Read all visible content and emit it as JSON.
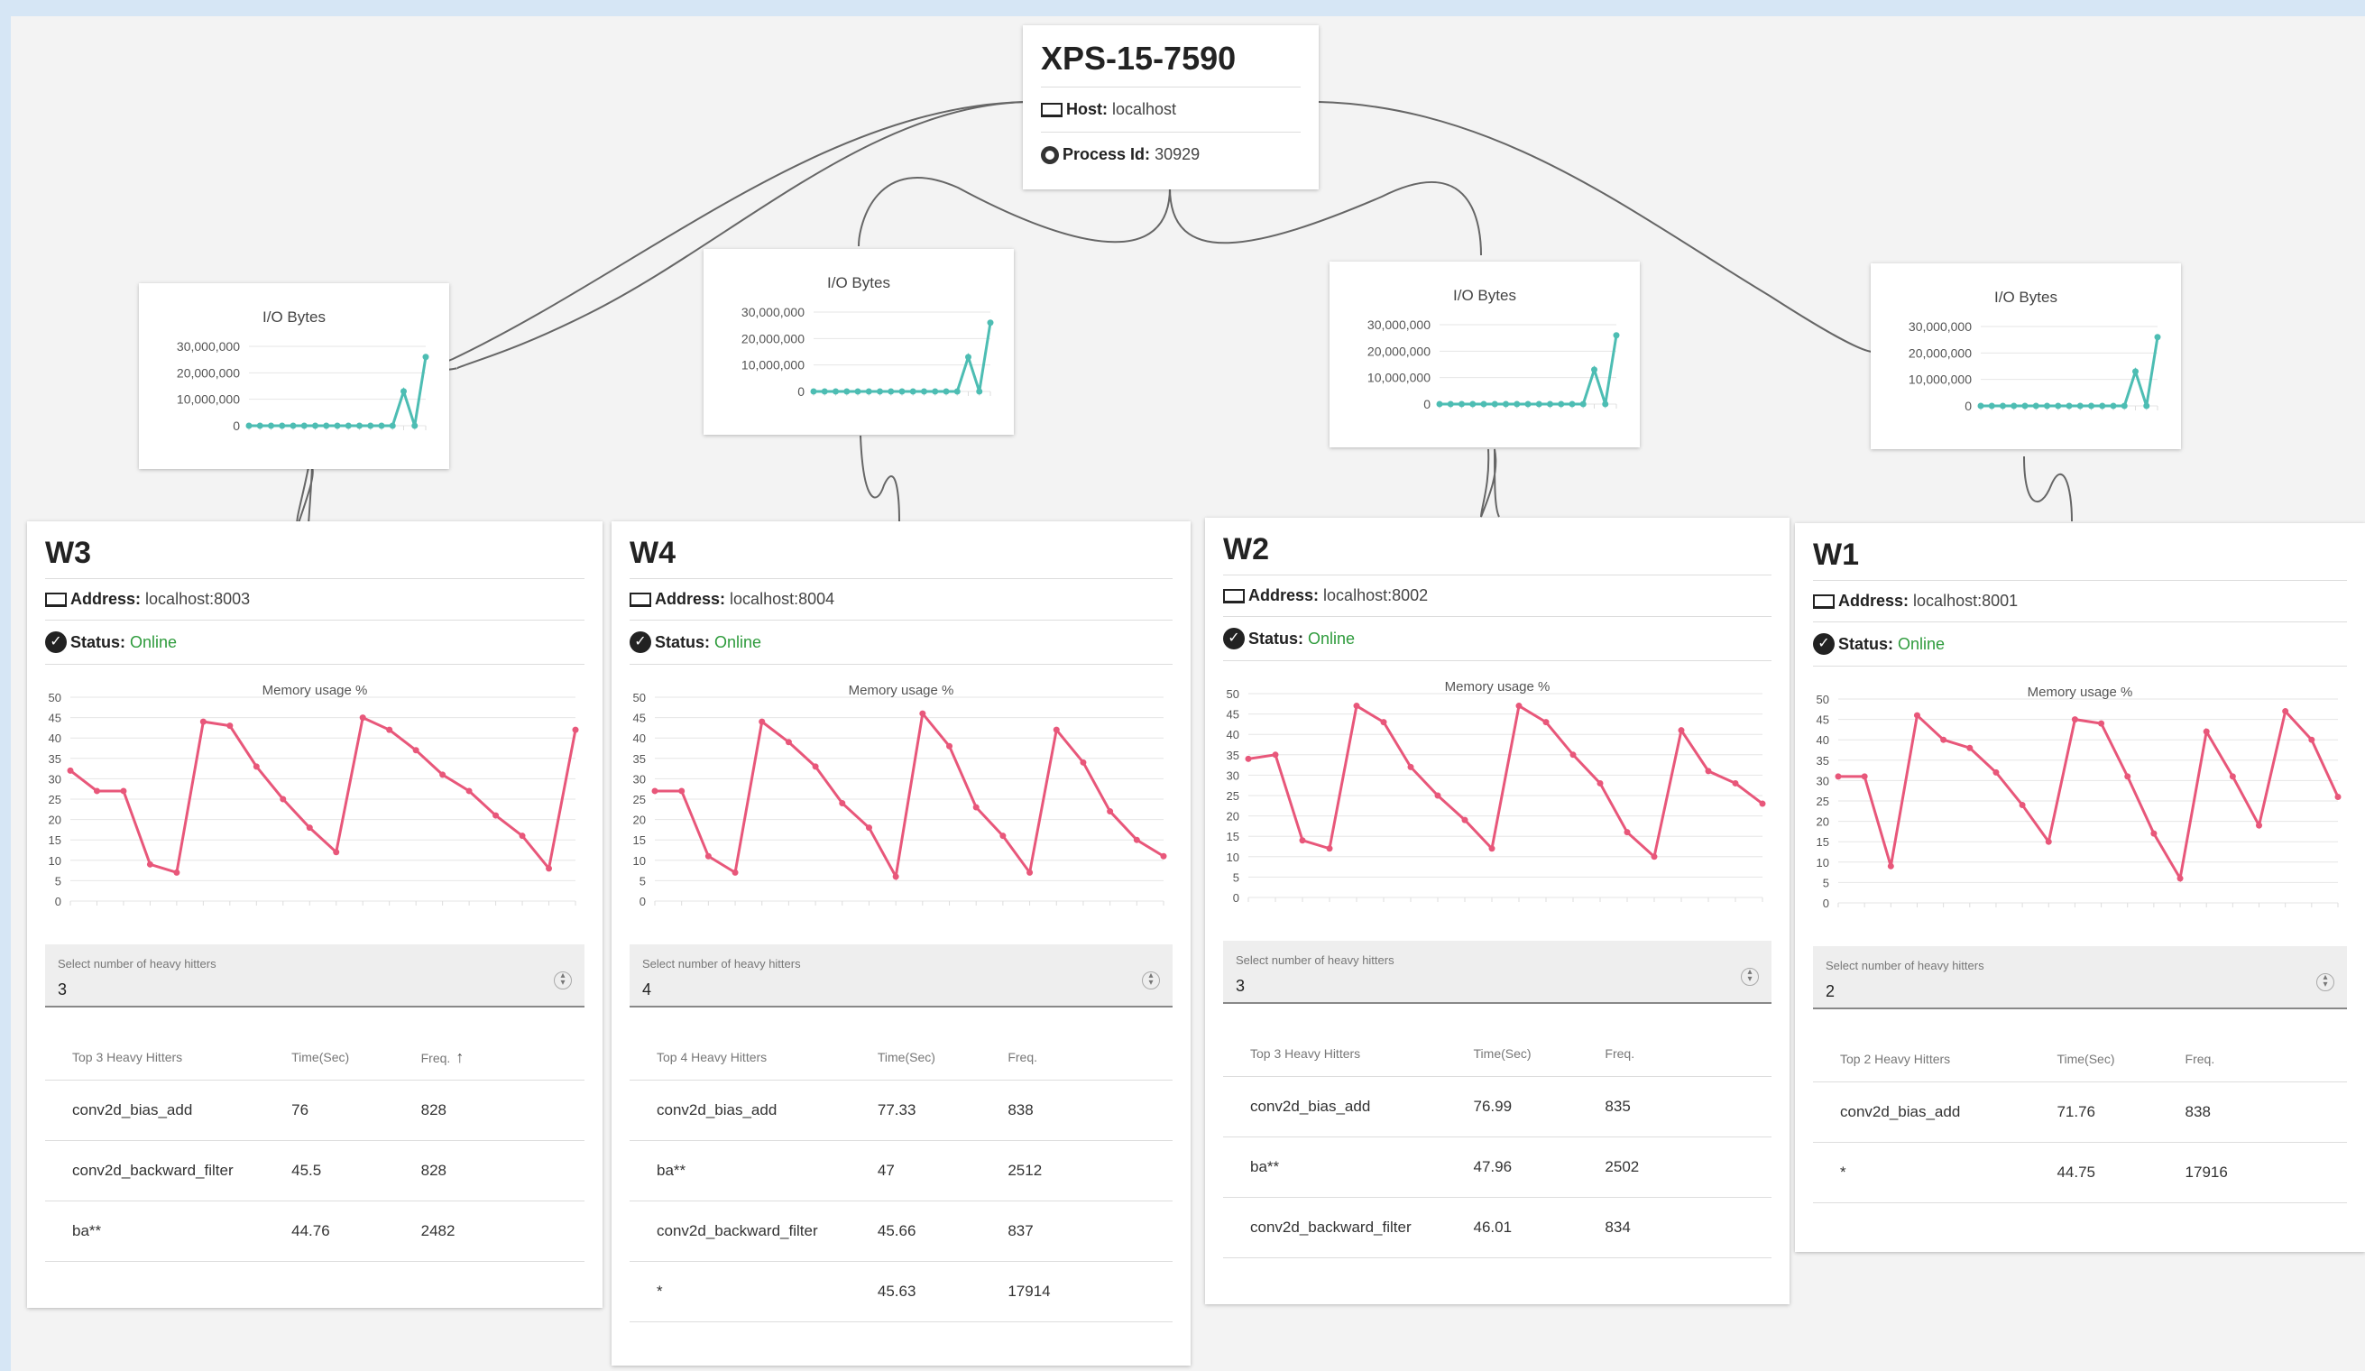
{
  "host": {
    "title": "XPS-15-7590",
    "host_label": "Host:",
    "host_value": "localhost",
    "pid_label": "Process Id:",
    "pid_value": "30929"
  },
  "io_chart": {
    "title": "I/O Bytes",
    "y_ticks": [
      "30,000,000",
      "20,000,000",
      "10,000,000",
      "0"
    ],
    "ylim": [
      0,
      30000000
    ],
    "color": "#4dbdb3"
  },
  "memory_chart": {
    "title": "Memory usage %",
    "y_ticks": [
      "50",
      "45",
      "40",
      "35",
      "30",
      "25",
      "20",
      "15",
      "10",
      "5",
      "0"
    ],
    "ylim": [
      0,
      50
    ],
    "color": "#e8577a"
  },
  "stepper_label": "Select number of heavy hitters",
  "col_time": "Time(Sec)",
  "col_freq": "Freq.",
  "address_label": "Address:",
  "status_label": "Status:",
  "chart_data": [
    {
      "type": "line",
      "title": "I/O Bytes",
      "ylabel": "",
      "xlabel": "",
      "ylim": [
        0,
        30000000
      ],
      "series": [
        {
          "values": [
            0,
            0,
            0,
            0,
            0,
            0,
            0,
            0,
            0,
            0,
            0,
            0,
            0,
            0,
            13000000,
            0,
            26000000
          ]
        }
      ]
    },
    {
      "type": "line",
      "title": "I/O Bytes",
      "ylabel": "",
      "xlabel": "",
      "ylim": [
        0,
        30000000
      ],
      "series": [
        {
          "values": [
            0,
            0,
            0,
            0,
            0,
            0,
            0,
            0,
            0,
            0,
            0,
            0,
            0,
            0,
            13000000,
            0,
            26000000
          ]
        }
      ]
    },
    {
      "type": "line",
      "title": "I/O Bytes",
      "ylabel": "",
      "xlabel": "",
      "ylim": [
        0,
        30000000
      ],
      "series": [
        {
          "values": [
            0,
            0,
            0,
            0,
            0,
            0,
            0,
            0,
            0,
            0,
            0,
            0,
            0,
            0,
            13000000,
            0,
            26000000
          ]
        }
      ]
    },
    {
      "type": "line",
      "title": "I/O Bytes",
      "ylabel": "",
      "xlabel": "",
      "ylim": [
        0,
        30000000
      ],
      "series": [
        {
          "values": [
            0,
            0,
            0,
            0,
            0,
            0,
            0,
            0,
            0,
            0,
            0,
            0,
            0,
            0,
            13000000,
            0,
            26000000
          ]
        }
      ]
    },
    {
      "type": "line",
      "title": "Memory usage %",
      "ylim": [
        0,
        50
      ],
      "series": [
        {
          "values": [
            32,
            27,
            27,
            9,
            7,
            44,
            43,
            33,
            25,
            18,
            12,
            45,
            42,
            37,
            31,
            27,
            21,
            16,
            8,
            42
          ]
        }
      ]
    },
    {
      "type": "line",
      "title": "Memory usage %",
      "ylim": [
        0,
        50
      ],
      "series": [
        {
          "values": [
            27,
            27,
            11,
            7,
            44,
            39,
            33,
            24,
            18,
            6,
            46,
            38,
            23,
            16,
            7,
            42,
            34,
            22,
            15,
            11
          ]
        }
      ]
    },
    {
      "type": "line",
      "title": "Memory usage %",
      "ylim": [
        0,
        50
      ],
      "series": [
        {
          "values": [
            34,
            35,
            14,
            12,
            47,
            43,
            32,
            25,
            19,
            12,
            47,
            43,
            35,
            28,
            16,
            10,
            41,
            31,
            28,
            23
          ]
        }
      ]
    },
    {
      "type": "line",
      "title": "Memory usage %",
      "ylim": [
        0,
        50
      ],
      "series": [
        {
          "values": [
            31,
            31,
            9,
            46,
            40,
            38,
            32,
            24,
            15,
            45,
            44,
            31,
            17,
            6,
            42,
            31,
            19,
            47,
            40,
            26
          ]
        }
      ]
    }
  ],
  "workers": [
    {
      "name": "W3",
      "address": "localhost:8003",
      "status": "Online",
      "heavy_hitters_count": "3",
      "table_title": "Top 3 Heavy Hitters",
      "sort_icon": "arrow-up",
      "rows": [
        {
          "name": "conv2d_bias_add",
          "time": "76",
          "freq": "828"
        },
        {
          "name": "conv2d_backward_filter",
          "time": "45.5",
          "freq": "828"
        },
        {
          "name": "ba**",
          "time": "44.76",
          "freq": "2482"
        }
      ]
    },
    {
      "name": "W4",
      "address": "localhost:8004",
      "status": "Online",
      "heavy_hitters_count": "4",
      "table_title": "Top 4 Heavy Hitters",
      "rows": [
        {
          "name": "conv2d_bias_add",
          "time": "77.33",
          "freq": "838"
        },
        {
          "name": "ba**",
          "time": "47",
          "freq": "2512"
        },
        {
          "name": "conv2d_backward_filter",
          "time": "45.66",
          "freq": "837"
        },
        {
          "name": "*",
          "time": "45.63",
          "freq": "17914"
        }
      ]
    },
    {
      "name": "W2",
      "address": "localhost:8002",
      "status": "Online",
      "heavy_hitters_count": "3",
      "table_title": "Top 3 Heavy Hitters",
      "rows": [
        {
          "name": "conv2d_bias_add",
          "time": "76.99",
          "freq": "835"
        },
        {
          "name": "ba**",
          "time": "47.96",
          "freq": "2502"
        },
        {
          "name": "conv2d_backward_filter",
          "time": "46.01",
          "freq": "834"
        }
      ]
    },
    {
      "name": "W1",
      "address": "localhost:8001",
      "status": "Online",
      "heavy_hitters_count": "2",
      "table_title": "Top 2 Heavy Hitters",
      "rows": [
        {
          "name": "conv2d_bias_add",
          "time": "71.76",
          "freq": "838"
        },
        {
          "name": "*",
          "time": "44.75",
          "freq": "17916"
        }
      ]
    }
  ]
}
